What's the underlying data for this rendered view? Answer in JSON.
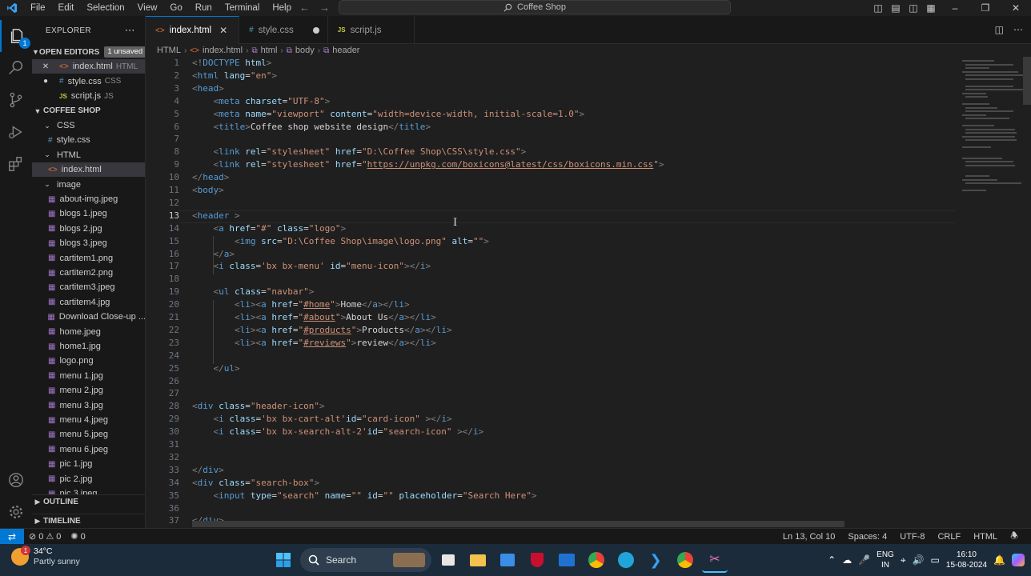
{
  "titlebar": {
    "menu": [
      "File",
      "Edit",
      "Selection",
      "View",
      "Go",
      "Run",
      "Terminal",
      "Help"
    ],
    "search_title": "Coffee Shop"
  },
  "activity_badge": "1",
  "sidebar": {
    "title": "EXPLORER",
    "open_editors_label": "OPEN EDITORS",
    "unsaved_label": "1 unsaved",
    "open_editors": [
      {
        "name": "index.html",
        "lang": "HTML",
        "state": "close"
      },
      {
        "name": "style.css",
        "lang": "CSS",
        "state": "dirty"
      },
      {
        "name": "script.js",
        "lang": "JS",
        "state": "none"
      }
    ],
    "project_label": "COFFEE SHOP",
    "tree": [
      {
        "name": "CSS",
        "type": "folder",
        "depth": 1
      },
      {
        "name": "style.css",
        "type": "css",
        "depth": 2
      },
      {
        "name": "HTML",
        "type": "folder",
        "depth": 1
      },
      {
        "name": "index.html",
        "type": "html",
        "depth": 2,
        "selected": true
      },
      {
        "name": "image",
        "type": "folder",
        "depth": 1
      },
      {
        "name": "about-img.jpeg",
        "type": "img",
        "depth": 2
      },
      {
        "name": "blogs 1.jpeg",
        "type": "img",
        "depth": 2
      },
      {
        "name": "blogs 2.jpg",
        "type": "img",
        "depth": 2
      },
      {
        "name": "blogs 3.jpeg",
        "type": "img",
        "depth": 2
      },
      {
        "name": "cartitem1.png",
        "type": "img",
        "depth": 2
      },
      {
        "name": "cartitem2.png",
        "type": "img",
        "depth": 2
      },
      {
        "name": "cartitem3.jpeg",
        "type": "img",
        "depth": 2
      },
      {
        "name": "cartitem4.jpg",
        "type": "img",
        "depth": 2
      },
      {
        "name": "Download Close-up ...",
        "type": "img",
        "depth": 2
      },
      {
        "name": "home.jpeg",
        "type": "img",
        "depth": 2
      },
      {
        "name": "home1.jpg",
        "type": "img",
        "depth": 2
      },
      {
        "name": "logo.png",
        "type": "img",
        "depth": 2
      },
      {
        "name": "menu 1.jpg",
        "type": "img",
        "depth": 2
      },
      {
        "name": "menu 2.jpg",
        "type": "img",
        "depth": 2
      },
      {
        "name": "menu 3.jpg",
        "type": "img",
        "depth": 2
      },
      {
        "name": "menu 4.jpeg",
        "type": "img",
        "depth": 2
      },
      {
        "name": "menu 5.jpeg",
        "type": "img",
        "depth": 2
      },
      {
        "name": "menu 6.jpeg",
        "type": "img",
        "depth": 2
      },
      {
        "name": "pic 1.jpg",
        "type": "img",
        "depth": 2
      },
      {
        "name": "pic 2.jpg",
        "type": "img",
        "depth": 2
      },
      {
        "name": "pic 3.jpeg",
        "type": "img",
        "depth": 2
      }
    ],
    "outline_label": "OUTLINE",
    "timeline_label": "TIMELINE"
  },
  "tabs": [
    {
      "name": "index.html",
      "icon": "<>",
      "active": true
    },
    {
      "name": "style.css",
      "icon": "#",
      "dirty": true
    },
    {
      "name": "script.js",
      "icon": "JS"
    }
  ],
  "breadcrumb": [
    "HTML",
    "index.html",
    "html",
    "body",
    "header"
  ],
  "editor": {
    "current_line": 13,
    "lines": [
      [
        [
          "br",
          "<!"
        ],
        [
          "tag",
          "DOCTYPE"
        ],
        [
          "tx",
          " "
        ],
        [
          "at",
          "html"
        ],
        [
          "br",
          ">"
        ]
      ],
      [
        [
          "br",
          "<"
        ],
        [
          "tag",
          "html"
        ],
        [
          "tx",
          " "
        ],
        [
          "at",
          "lang"
        ],
        [
          "eq",
          "="
        ],
        [
          "st",
          "\"en\""
        ],
        [
          "br",
          ">"
        ]
      ],
      [
        [
          "br",
          "<"
        ],
        [
          "tag",
          "head"
        ],
        [
          "br",
          ">"
        ]
      ],
      [
        [
          "tx",
          "    "
        ],
        [
          "br",
          "<"
        ],
        [
          "tag",
          "meta"
        ],
        [
          "tx",
          " "
        ],
        [
          "at",
          "charset"
        ],
        [
          "eq",
          "="
        ],
        [
          "st",
          "\"UTF-8\""
        ],
        [
          "br",
          ">"
        ]
      ],
      [
        [
          "tx",
          "    "
        ],
        [
          "br",
          "<"
        ],
        [
          "tag",
          "meta"
        ],
        [
          "tx",
          " "
        ],
        [
          "at",
          "name"
        ],
        [
          "eq",
          "="
        ],
        [
          "st",
          "\"viewport\""
        ],
        [
          "tx",
          " "
        ],
        [
          "at",
          "content"
        ],
        [
          "eq",
          "="
        ],
        [
          "st",
          "\"width=device-width, initial-scale=1.0\""
        ],
        [
          "br",
          ">"
        ]
      ],
      [
        [
          "tx",
          "    "
        ],
        [
          "br",
          "<"
        ],
        [
          "tag",
          "title"
        ],
        [
          "br",
          ">"
        ],
        [
          "tx",
          "Coffee shop website design"
        ],
        [
          "br",
          "</"
        ],
        [
          "tag",
          "title"
        ],
        [
          "br",
          ">"
        ]
      ],
      [],
      [
        [
          "tx",
          "    "
        ],
        [
          "br",
          "<"
        ],
        [
          "tag",
          "link"
        ],
        [
          "tx",
          " "
        ],
        [
          "at",
          "rel"
        ],
        [
          "eq",
          "="
        ],
        [
          "st",
          "\"stylesheet\""
        ],
        [
          "tx",
          " "
        ],
        [
          "at",
          "href"
        ],
        [
          "eq",
          "="
        ],
        [
          "st",
          "\"D:\\Coffee Shop\\CSS\\style.css\""
        ],
        [
          "br",
          ">"
        ]
      ],
      [
        [
          "tx",
          "    "
        ],
        [
          "br",
          "<"
        ],
        [
          "tag",
          "link"
        ],
        [
          "tx",
          " "
        ],
        [
          "at",
          "rel"
        ],
        [
          "eq",
          "="
        ],
        [
          "st",
          "\"stylesheet\""
        ],
        [
          "tx",
          " "
        ],
        [
          "at",
          "href"
        ],
        [
          "eq",
          "="
        ],
        [
          "st",
          "\""
        ],
        [
          "lk",
          "https://unpkg.com/boxicons@latest/css/boxicons.min.css"
        ],
        [
          "st",
          "\""
        ],
        [
          "br",
          ">"
        ]
      ],
      [
        [
          "br",
          "</"
        ],
        [
          "tag",
          "head"
        ],
        [
          "br",
          ">"
        ]
      ],
      [
        [
          "br",
          "<"
        ],
        [
          "tag",
          "body"
        ],
        [
          "br",
          ">"
        ]
      ],
      [],
      [
        [
          "br",
          "<"
        ],
        [
          "tag",
          "header"
        ],
        [
          "tx",
          " "
        ],
        [
          "br",
          ">"
        ]
      ],
      [
        [
          "tx",
          "    "
        ],
        [
          "br",
          "<"
        ],
        [
          "tag",
          "a"
        ],
        [
          "tx",
          " "
        ],
        [
          "at",
          "href"
        ],
        [
          "eq",
          "="
        ],
        [
          "st",
          "\"#\""
        ],
        [
          "tx",
          " "
        ],
        [
          "at",
          "class"
        ],
        [
          "eq",
          "="
        ],
        [
          "st",
          "\"logo\""
        ],
        [
          "br",
          ">"
        ]
      ],
      [
        [
          "tx",
          "        "
        ],
        [
          "br",
          "<"
        ],
        [
          "tag",
          "img"
        ],
        [
          "tx",
          " "
        ],
        [
          "at",
          "src"
        ],
        [
          "eq",
          "="
        ],
        [
          "st",
          "\"D:\\Coffee Shop\\image\\logo.png\""
        ],
        [
          "tx",
          " "
        ],
        [
          "at",
          "alt"
        ],
        [
          "eq",
          "="
        ],
        [
          "st",
          "\"\""
        ],
        [
          "br",
          ">"
        ]
      ],
      [
        [
          "tx",
          "    "
        ],
        [
          "br",
          "</"
        ],
        [
          "tag",
          "a"
        ],
        [
          "br",
          ">"
        ]
      ],
      [
        [
          "tx",
          "    "
        ],
        [
          "br",
          "<"
        ],
        [
          "tag",
          "i"
        ],
        [
          "tx",
          " "
        ],
        [
          "at",
          "class"
        ],
        [
          "eq",
          "="
        ],
        [
          "st",
          "'bx bx-menu'"
        ],
        [
          "tx",
          " "
        ],
        [
          "at",
          "id"
        ],
        [
          "eq",
          "="
        ],
        [
          "st",
          "\"menu-icon\""
        ],
        [
          "br",
          "></"
        ],
        [
          "tag",
          "i"
        ],
        [
          "br",
          ">"
        ]
      ],
      [],
      [
        [
          "tx",
          "    "
        ],
        [
          "br",
          "<"
        ],
        [
          "tag",
          "ul"
        ],
        [
          "tx",
          " "
        ],
        [
          "at",
          "class"
        ],
        [
          "eq",
          "="
        ],
        [
          "st",
          "\"navbar\""
        ],
        [
          "br",
          ">"
        ]
      ],
      [
        [
          "tx",
          "        "
        ],
        [
          "br",
          "<"
        ],
        [
          "tag",
          "li"
        ],
        [
          "br",
          "><"
        ],
        [
          "tag",
          "a"
        ],
        [
          "tx",
          " "
        ],
        [
          "at",
          "href"
        ],
        [
          "eq",
          "="
        ],
        [
          "st",
          "\""
        ],
        [
          "lk",
          "#home"
        ],
        [
          "st",
          "\""
        ],
        [
          "br",
          ">"
        ],
        [
          "tx",
          "Home"
        ],
        [
          "br",
          "</"
        ],
        [
          "tag",
          "a"
        ],
        [
          "br",
          "></"
        ],
        [
          "tag",
          "li"
        ],
        [
          "br",
          ">"
        ]
      ],
      [
        [
          "tx",
          "        "
        ],
        [
          "br",
          "<"
        ],
        [
          "tag",
          "li"
        ],
        [
          "br",
          "><"
        ],
        [
          "tag",
          "a"
        ],
        [
          "tx",
          " "
        ],
        [
          "at",
          "href"
        ],
        [
          "eq",
          "="
        ],
        [
          "st",
          "\""
        ],
        [
          "lk",
          "#about"
        ],
        [
          "st",
          "\""
        ],
        [
          "br",
          ">"
        ],
        [
          "tx",
          "About Us"
        ],
        [
          "br",
          "</"
        ],
        [
          "tag",
          "a"
        ],
        [
          "br",
          "></"
        ],
        [
          "tag",
          "li"
        ],
        [
          "br",
          ">"
        ]
      ],
      [
        [
          "tx",
          "        "
        ],
        [
          "br",
          "<"
        ],
        [
          "tag",
          "li"
        ],
        [
          "br",
          "><"
        ],
        [
          "tag",
          "a"
        ],
        [
          "tx",
          " "
        ],
        [
          "at",
          "href"
        ],
        [
          "eq",
          "="
        ],
        [
          "st",
          "\""
        ],
        [
          "lk",
          "#products"
        ],
        [
          "st",
          "\""
        ],
        [
          "br",
          ">"
        ],
        [
          "tx",
          "Products"
        ],
        [
          "br",
          "</"
        ],
        [
          "tag",
          "a"
        ],
        [
          "br",
          "></"
        ],
        [
          "tag",
          "li"
        ],
        [
          "br",
          ">"
        ]
      ],
      [
        [
          "tx",
          "        "
        ],
        [
          "br",
          "<"
        ],
        [
          "tag",
          "li"
        ],
        [
          "br",
          "><"
        ],
        [
          "tag",
          "a"
        ],
        [
          "tx",
          " "
        ],
        [
          "at",
          "href"
        ],
        [
          "eq",
          "="
        ],
        [
          "st",
          "\""
        ],
        [
          "lk",
          "#reviews"
        ],
        [
          "st",
          "\""
        ],
        [
          "br",
          ">"
        ],
        [
          "tx",
          "review"
        ],
        [
          "br",
          "</"
        ],
        [
          "tag",
          "a"
        ],
        [
          "br",
          "></"
        ],
        [
          "tag",
          "li"
        ],
        [
          "br",
          ">"
        ]
      ],
      [],
      [
        [
          "tx",
          "    "
        ],
        [
          "br",
          "</"
        ],
        [
          "tag",
          "ul"
        ],
        [
          "br",
          ">"
        ]
      ],
      [],
      [],
      [
        [
          "br",
          "<"
        ],
        [
          "tag",
          "div"
        ],
        [
          "tx",
          " "
        ],
        [
          "at",
          "class"
        ],
        [
          "eq",
          "="
        ],
        [
          "st",
          "\"header-icon\""
        ],
        [
          "br",
          ">"
        ]
      ],
      [
        [
          "tx",
          "    "
        ],
        [
          "br",
          "<"
        ],
        [
          "tag",
          "i"
        ],
        [
          "tx",
          " "
        ],
        [
          "at",
          "class"
        ],
        [
          "eq",
          "="
        ],
        [
          "st",
          "'bx bx-cart-alt'"
        ],
        [
          "at",
          "id"
        ],
        [
          "eq",
          "="
        ],
        [
          "st",
          "\"card-icon\""
        ],
        [
          "tx",
          " "
        ],
        [
          "br",
          "></"
        ],
        [
          "tag",
          "i"
        ],
        [
          "br",
          ">"
        ]
      ],
      [
        [
          "tx",
          "    "
        ],
        [
          "br",
          "<"
        ],
        [
          "tag",
          "i"
        ],
        [
          "tx",
          " "
        ],
        [
          "at",
          "class"
        ],
        [
          "eq",
          "="
        ],
        [
          "st",
          "'bx bx-search-alt-2'"
        ],
        [
          "at",
          "id"
        ],
        [
          "eq",
          "="
        ],
        [
          "st",
          "\"search-icon\""
        ],
        [
          "tx",
          " "
        ],
        [
          "br",
          "></"
        ],
        [
          "tag",
          "i"
        ],
        [
          "br",
          ">"
        ]
      ],
      [],
      [],
      [
        [
          "br",
          "</"
        ],
        [
          "tag",
          "div"
        ],
        [
          "br",
          ">"
        ]
      ],
      [
        [
          "br",
          "<"
        ],
        [
          "tag",
          "div"
        ],
        [
          "tx",
          " "
        ],
        [
          "at",
          "class"
        ],
        [
          "eq",
          "="
        ],
        [
          "st",
          "\"search-box\""
        ],
        [
          "br",
          ">"
        ]
      ],
      [
        [
          "tx",
          "    "
        ],
        [
          "br",
          "<"
        ],
        [
          "tag",
          "input"
        ],
        [
          "tx",
          " "
        ],
        [
          "at",
          "type"
        ],
        [
          "eq",
          "="
        ],
        [
          "st",
          "\"search\""
        ],
        [
          "tx",
          " "
        ],
        [
          "at",
          "name"
        ],
        [
          "eq",
          "="
        ],
        [
          "st",
          "\"\""
        ],
        [
          "tx",
          " "
        ],
        [
          "at",
          "id"
        ],
        [
          "eq",
          "="
        ],
        [
          "st",
          "\"\""
        ],
        [
          "tx",
          " "
        ],
        [
          "at",
          "placeholder"
        ],
        [
          "eq",
          "="
        ],
        [
          "st",
          "\"Search Here\""
        ],
        [
          "br",
          ">"
        ]
      ],
      [],
      [
        [
          "br",
          "</"
        ],
        [
          "tag",
          "div"
        ],
        [
          "br",
          ">"
        ]
      ]
    ]
  },
  "statusbar": {
    "errors": "0",
    "warnings": "0",
    "ports": "0",
    "position": "Ln 13, Col 10",
    "spaces": "Spaces: 4",
    "encoding": "UTF-8",
    "eol": "CRLF",
    "language": "HTML"
  },
  "taskbar": {
    "weather_badge": "1",
    "temp": "34°C",
    "condition": "Partly sunny",
    "search_label": "Search",
    "lang_top": "ENG",
    "lang_bottom": "IN",
    "time": "16:10",
    "date": "15-08-2024"
  },
  "colors": {
    "accent": "#0078d4",
    "editor_bg": "#1f1f1f",
    "sidebar_bg": "#181818",
    "taskbar_bg": "#1c2b3a"
  }
}
